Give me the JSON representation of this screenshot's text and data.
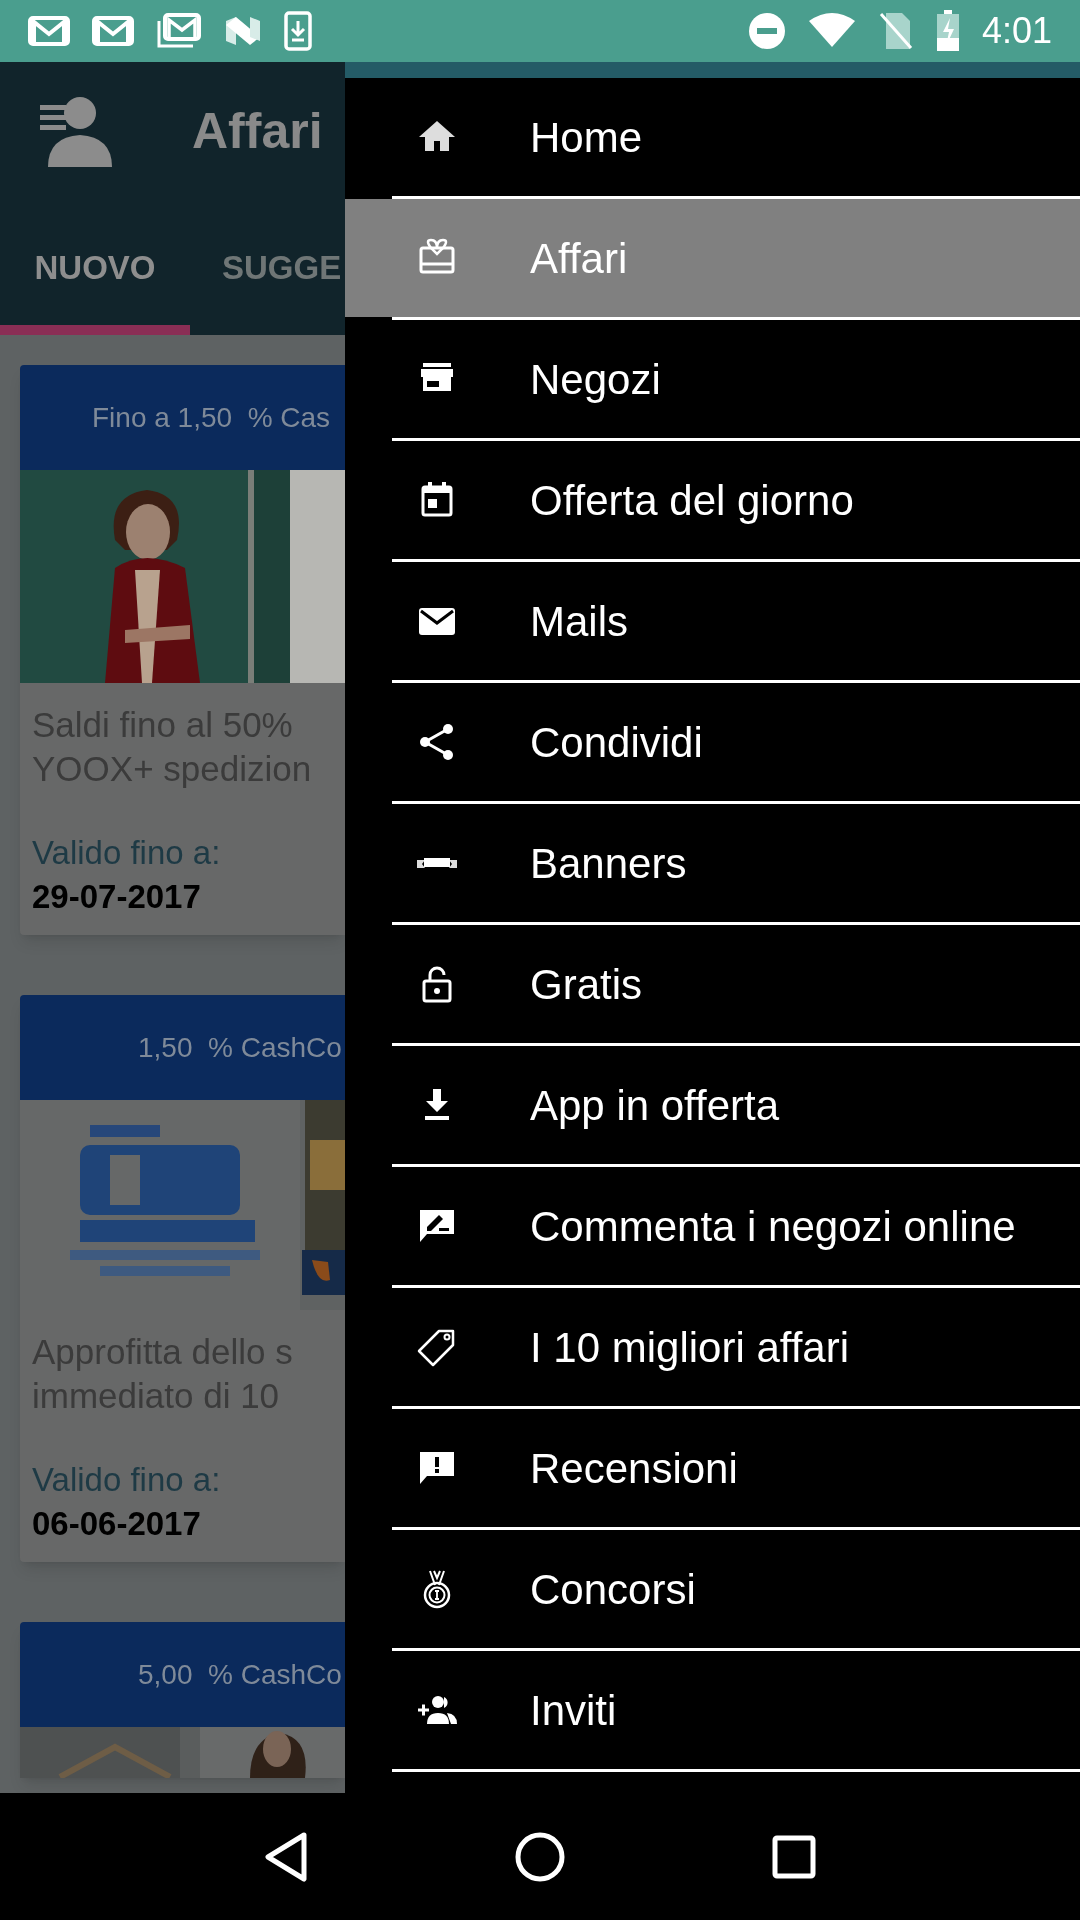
{
  "status_bar": {
    "time": "4:01"
  },
  "app_bar": {
    "title": "Affari"
  },
  "tabs": [
    {
      "label": "NUOVO",
      "selected": true
    },
    {
      "label": "SUGGE",
      "selected": false
    }
  ],
  "cards": [
    {
      "cashback": "Fino a 1,50  % Cas",
      "title_lines": [
        "Saldi fino al 50%",
        "YOOX+ spedizion"
      ],
      "valid_label": "Valido fino a:",
      "valid_date": "29-07-2017"
    },
    {
      "cashback": "1,50  % CashCo",
      "title_lines": [
        "Approfitta dello s",
        "immediato di 10"
      ],
      "valid_label": "Valido fino a:",
      "valid_date": "06-06-2017"
    },
    {
      "cashback": "5,00  % CashCo"
    }
  ],
  "drawer": {
    "items": [
      {
        "label": "Home",
        "selected": false
      },
      {
        "label": "Affari",
        "selected": true
      },
      {
        "label": "Negozi",
        "selected": false
      },
      {
        "label": "Offerta del giorno",
        "selected": false
      },
      {
        "label": "Mails",
        "selected": false
      },
      {
        "label": "Condividi",
        "selected": false
      },
      {
        "label": "Banners",
        "selected": false
      },
      {
        "label": "Gratis",
        "selected": false
      },
      {
        "label": "App in offerta",
        "selected": false
      },
      {
        "label": "Commenta i negozi online",
        "selected": false
      },
      {
        "label": "I 10 migliori affari",
        "selected": false
      },
      {
        "label": "Recensioni",
        "selected": false
      },
      {
        "label": "Concorsi",
        "selected": false
      },
      {
        "label": "Inviti",
        "selected": false
      }
    ]
  }
}
